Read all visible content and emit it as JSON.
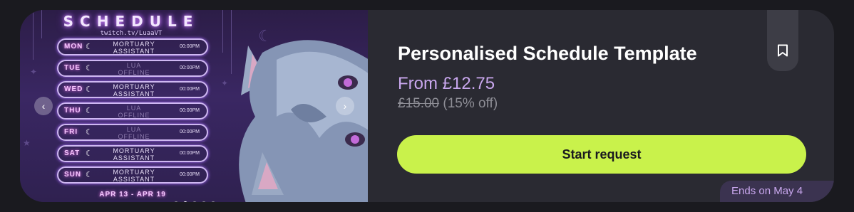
{
  "product": {
    "title": "Personalised Schedule Template",
    "price_from": "From £12.75",
    "price_original": "£15.00",
    "discount": "(15% off)",
    "cta_label": "Start request",
    "ends_label": "Ends on May 4"
  },
  "gallery": {
    "prev_icon": "‹",
    "next_icon": "›",
    "slide_count": 5,
    "active_slide": 2,
    "image": {
      "heading": "SCHEDULE",
      "subheading": "twitch.tv/LuaaVT",
      "rows": [
        {
          "day": "MON",
          "line1": "MORTUARY",
          "line2": "ASSISTANT",
          "time": "00:00PM",
          "dim": false
        },
        {
          "day": "TUE",
          "line1": "LUA",
          "line2": "OFFLINE",
          "time": "00:00PM",
          "dim": true
        },
        {
          "day": "WED",
          "line1": "MORTUARY",
          "line2": "ASSISTANT",
          "time": "00:00PM",
          "dim": false
        },
        {
          "day": "THU",
          "line1": "LUA",
          "line2": "OFFLINE",
          "time": "00:00PM",
          "dim": true
        },
        {
          "day": "FRI",
          "line1": "LUA",
          "line2": "OFFLINE",
          "time": "00:00PM",
          "dim": true
        },
        {
          "day": "SAT",
          "line1": "MORTUARY",
          "line2": "ASSISTANT",
          "time": "00:00PM",
          "dim": false
        },
        {
          "day": "SUN",
          "line1": "MORTUARY",
          "line2": "ASSISTANT",
          "time": "00:00PM",
          "dim": false
        }
      ],
      "date_range": "APR 13 - APR 19"
    }
  },
  "icons": {
    "bookmark": "bookmark-icon",
    "prev": "chevron-left-icon",
    "next": "chevron-right-icon"
  },
  "colors": {
    "card_bg": "#2a2a32",
    "accent_lime": "#c9f24b",
    "price_purple": "#c9a7ee"
  }
}
